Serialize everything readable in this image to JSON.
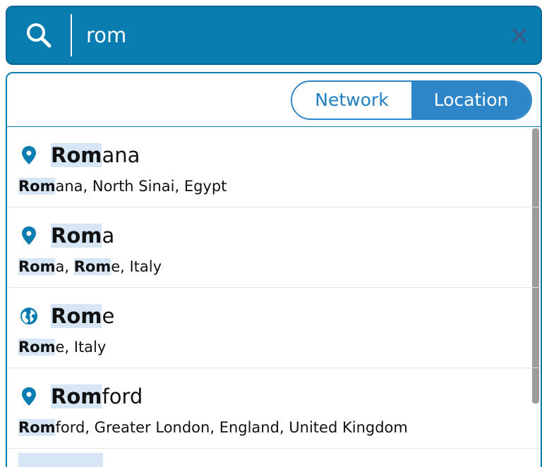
{
  "search": {
    "query": "rom",
    "icon": "search-icon",
    "clear_icon": "close-icon"
  },
  "toggle": {
    "options": [
      "Network",
      "Location"
    ],
    "selected": "Location"
  },
  "results": [
    {
      "icon": "map-pin-icon",
      "name_highlight": "Rom",
      "name_rest": "ana",
      "sub": [
        {
          "text": "Rom",
          "hl": true
        },
        {
          "text": "ana, North Sinai, Egypt",
          "hl": false
        }
      ]
    },
    {
      "icon": "map-pin-icon",
      "name_highlight": "Rom",
      "name_rest": "a",
      "sub": [
        {
          "text": "Rom",
          "hl": true
        },
        {
          "text": "a, ",
          "hl": false
        },
        {
          "text": "Rom",
          "hl": true
        },
        {
          "text": "e, Italy",
          "hl": false
        }
      ]
    },
    {
      "icon": "globe-icon",
      "name_highlight": "Rom",
      "name_rest": "e",
      "sub": [
        {
          "text": "Rom",
          "hl": true
        },
        {
          "text": "e, Italy",
          "hl": false
        }
      ]
    },
    {
      "icon": "map-pin-icon",
      "name_highlight": "Rom",
      "name_rest": "ford",
      "sub": [
        {
          "text": "Rom",
          "hl": true
        },
        {
          "text": "ford, Greater London, England, United Kingdom",
          "hl": false
        }
      ]
    }
  ],
  "colors": {
    "accent": "#0a7db0",
    "toggle_active": "#2e86c8",
    "highlight": "#d6e6f5"
  }
}
